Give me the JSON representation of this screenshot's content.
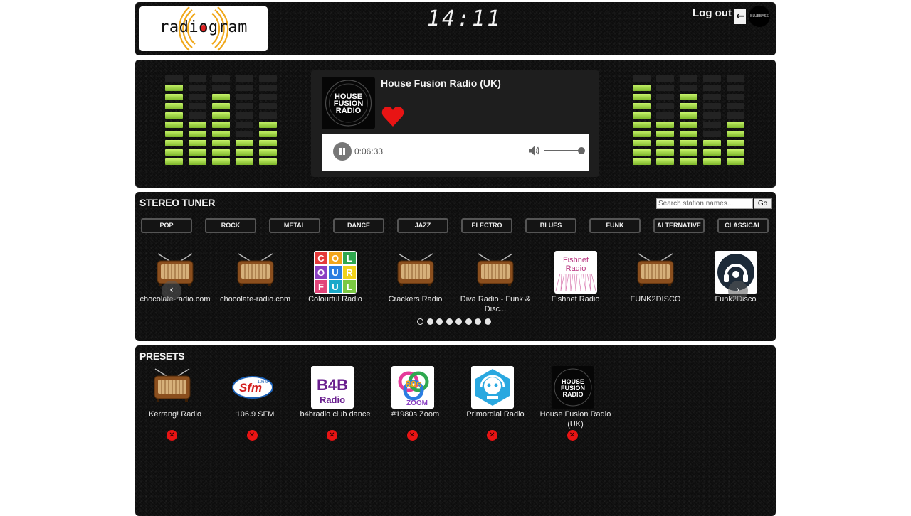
{
  "header": {
    "logo_text": "radiogram",
    "clock": "14:11",
    "logout_label": "Log out",
    "logout_icon": "arrow-left-icon",
    "avatar_text": "BLUEBASS"
  },
  "player": {
    "station_name": "House Fusion Radio (UK)",
    "thumb_text": "HOUSE FUSION RADIO",
    "favorite_icon": "heart-icon",
    "elapsed": "0:06:33",
    "volume_level": 1.0,
    "state": "playing"
  },
  "equalizer": {
    "levels": [
      9,
      5,
      8,
      3,
      5
    ]
  },
  "tuner": {
    "title": "STEREO TUNER",
    "search_placeholder": "Search station names...",
    "go_label": "Go",
    "genres": [
      "POP",
      "ROCK",
      "METAL",
      "DANCE",
      "JAZZ",
      "ELECTRO",
      "BLUES",
      "FUNK",
      "ALTERNATIVE",
      "CLASSICAL"
    ],
    "stations": [
      {
        "name": "chocolate-radio.com",
        "logo": "radio-icon"
      },
      {
        "name": "chocolate-radio.com",
        "logo": "radio-icon"
      },
      {
        "name": "Colourful Radio",
        "logo": "colourful-logo"
      },
      {
        "name": "Crackers Radio",
        "logo": "radio-icon"
      },
      {
        "name": "Diva Radio - Funk & Disc...",
        "logo": "radio-icon"
      },
      {
        "name": "Fishnet Radio",
        "logo": "fishnet-logo"
      },
      {
        "name": "FUNK2DISCO",
        "logo": "radio-icon"
      },
      {
        "name": "Funk2Disco",
        "logo": "headphones-logo"
      }
    ],
    "colourful_letters": [
      "C",
      "O",
      "L",
      "O",
      "U",
      "R",
      "F",
      "U",
      "L"
    ],
    "fishnet_text": "Fishnet Radio",
    "pager": {
      "pages": 8,
      "active": 1
    },
    "prev_icon": "chevron-left-icon",
    "next_icon": "chevron-right-icon"
  },
  "presets": {
    "title": "PRESETS",
    "items": [
      {
        "name": "Kerrang! Radio",
        "logo": "radio-icon"
      },
      {
        "name": "106.9 SFM",
        "logo": "sfm-logo"
      },
      {
        "name": "b4bradio club dance",
        "logo": "b4b-logo"
      },
      {
        "name": "#1980s Zoom",
        "logo": "80s-zoom-logo"
      },
      {
        "name": "Primordial Radio",
        "logo": "primordial-logo"
      },
      {
        "name": "House Fusion Radio (UK)",
        "logo": "house-fusion-logo"
      }
    ],
    "remove_glyph": "✕",
    "sfm_text": "Sfm",
    "sfm_freq": "106.9",
    "b4b_text": "B4B",
    "b4b_sub": "Radio",
    "zoom_text": "80s",
    "zoom_sub": "ZOOM",
    "house_fusion_text": "HOUSE FUSION RADIO"
  },
  "colors": {
    "eq_on": "#9bd236",
    "favorite": "#e81414",
    "remove": "#e81414"
  }
}
